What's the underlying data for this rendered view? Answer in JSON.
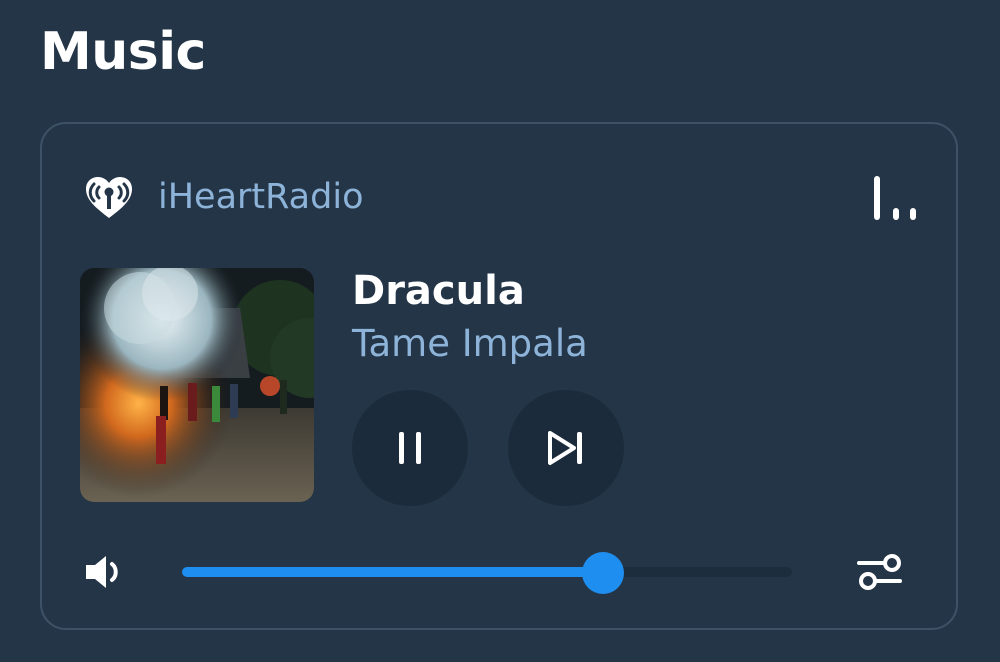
{
  "page": {
    "title": "Music"
  },
  "player": {
    "source": {
      "name": "iHeartRadio",
      "logo_icon": "iheartradio-logo"
    },
    "equalizer_icon": "bars-icon",
    "track": {
      "title": "Dracula",
      "artist": "Tame Impala"
    },
    "controls": {
      "pause_icon": "pause-icon",
      "next_icon": "skip-next-icon"
    },
    "volume": {
      "icon": "volume-icon",
      "level_percent": 69
    },
    "settings_icon": "sliders-icon"
  },
  "colors": {
    "background": "#243547",
    "accent": "#1f8ef1",
    "secondary_text": "#8db3d9",
    "button_bg": "#1b2b3b",
    "card_border": "#3e5267"
  }
}
